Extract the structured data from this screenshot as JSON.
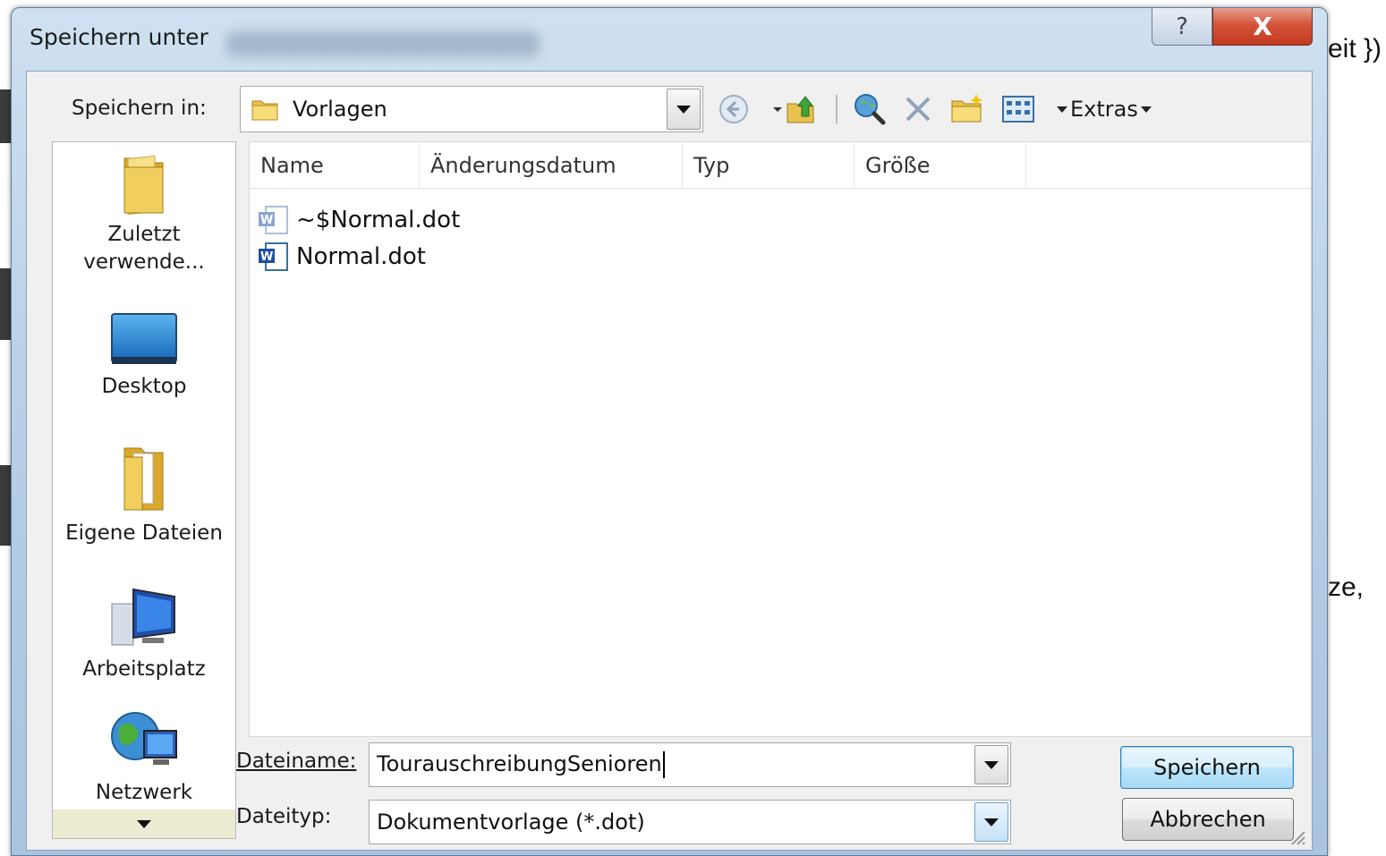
{
  "dialog": {
    "title": "Speichern unter",
    "help_glyph": "?",
    "close_glyph": "X"
  },
  "background_doc": {
    "text_right_top": "eit })",
    "text_right_mid": "ze,"
  },
  "toolbar": {
    "save_in_label": "Speichern in:",
    "save_in_value": "Vorlagen",
    "extras_label": "Extras",
    "icons": [
      "back-icon",
      "up-folder-icon",
      "search-web-icon",
      "delete-icon",
      "new-folder-icon",
      "views-icon"
    ]
  },
  "places": [
    {
      "label1": "Zuletzt",
      "label2": "verwende...",
      "icon": "recent-folder-icon"
    },
    {
      "label1": "Desktop",
      "label2": "",
      "icon": "desktop-icon"
    },
    {
      "label1": "Eigene Dateien",
      "label2": "",
      "icon": "my-documents-icon"
    },
    {
      "label1": "Arbeitsplatz",
      "label2": "",
      "icon": "my-computer-icon"
    },
    {
      "label1": "Netzwerk",
      "label2": "",
      "icon": "network-icon"
    }
  ],
  "filelist": {
    "columns": [
      "Name",
      "Änderungsdatum",
      "Typ",
      "Größe"
    ],
    "files": [
      {
        "name": "~$Normal.dot",
        "icon": "word-template-icon"
      },
      {
        "name": "Normal.dot",
        "icon": "word-template-icon"
      }
    ]
  },
  "form": {
    "filename_label": "Dateiname:",
    "filename_value": "TourauschreibungSenioren",
    "filetype_label": "Dateityp:",
    "filetype_value": "Dokumentvorlage (*.dot)"
  },
  "buttons": {
    "save": "Speichern",
    "cancel": "Abbrechen"
  },
  "colors": {
    "frame": "#b8d0e8",
    "close": "#c23a20",
    "default_button_border": "#3c7fb1"
  }
}
